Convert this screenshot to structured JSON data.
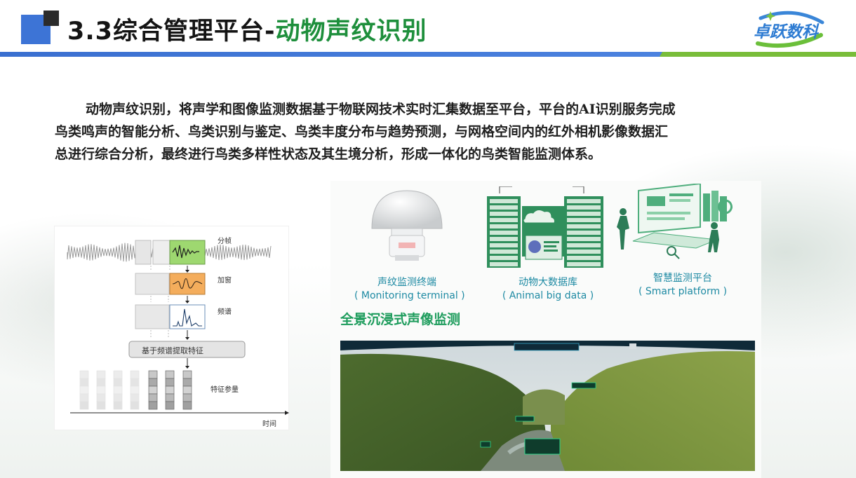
{
  "header": {
    "title_prefix": "3.3综合管理平台-",
    "title_highlight": "动物声纹识别",
    "brand": "卓跃数科"
  },
  "intro": {
    "lines": [
      "动物声纹识别，将声学和图像监测数据基于物联网技术实时汇集数据至平台，平台的AI识别服务完成",
      "鸟类鸣声的智能分析、鸟类识别与鉴定、鸟类丰度分布与趋势预测，与网格空间内的红外相机影像数据汇",
      "总进行综合分析，最终进行鸟类多样性状态及其生境分析，形成一体化的鸟类智能监测体系。"
    ]
  },
  "diagram": {
    "framing_label": "分帧",
    "window_label": "加窗",
    "spectrum_label": "频谱",
    "extract_label": "基于频谱提取特征",
    "feature_label": "特征参量",
    "time_label": "时间"
  },
  "products": [
    {
      "name": "声纹监测终端",
      "en": "( Monitoring terminal )",
      "icon": "dome-sensor-icon"
    },
    {
      "name": "动物大数据库",
      "en": "( Animal big data )",
      "icon": "data-server-icon"
    },
    {
      "name": "智慧监测平台",
      "en": "( Smart platform )",
      "icon": "smart-platform-icon"
    }
  ],
  "panorama": {
    "title": "全景沉浸式声像监测"
  },
  "colors": {
    "accent_blue": "#3d74d6",
    "accent_green": "#1e8f3c",
    "caption_teal": "#1e8aa3"
  }
}
